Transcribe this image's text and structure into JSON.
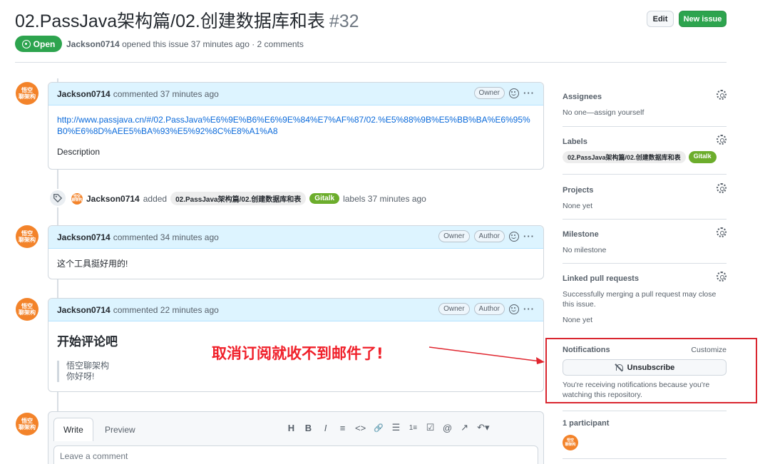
{
  "header": {
    "title": "02.PassJava架构篇/02.创建数据库和表",
    "number": "#32",
    "edit_label": "Edit",
    "new_issue_label": "New issue",
    "state": "Open",
    "author": "Jackson0714",
    "meta_text": "opened this issue 37 minutes ago · 2 comments"
  },
  "avatar_text": "悟空\n聊架构",
  "comments": [
    {
      "author": "Jackson0714",
      "action": "commented 37 minutes ago",
      "roles": [
        "Owner"
      ],
      "link": "http://www.passjava.cn/#/02.PassJava%E6%9E%B6%E6%9E%84%E7%AF%87/02.%E5%88%9B%E5%BB%BA%E6%95%B0%E6%8D%AEE5%BA%93%E5%92%8C%E8%A1%A8",
      "body": "Description"
    },
    {
      "author": "Jackson0714",
      "action": "commented 34 minutes ago",
      "roles": [
        "Owner",
        "Author"
      ],
      "body": "这个工具挺好用的!"
    },
    {
      "author": "Jackson0714",
      "action": "commented 22 minutes ago",
      "roles": [
        "Owner",
        "Author"
      ],
      "heading": "开始评论吧",
      "quote_lines": [
        "悟空聊架构",
        "你好呀!"
      ]
    }
  ],
  "label_event": {
    "author": "Jackson0714",
    "verb": "added",
    "labels": [
      "02.PassJava架构篇/02.创建数据库和表",
      "Gitalk"
    ],
    "suffix": "labels 37 minutes ago"
  },
  "annotation": {
    "text": "取消订阅就收不到邮件了!",
    "color": "#f0202a"
  },
  "editor": {
    "tab_write": "Write",
    "tab_preview": "Preview",
    "toolbar": [
      "H",
      "B",
      "I",
      "≡",
      "<>",
      "🔗",
      "☰",
      "1≡",
      "☑",
      "@",
      "↗",
      "↶▾"
    ],
    "placeholder": "Leave a comment"
  },
  "sidebar": {
    "assignees_title": "Assignees",
    "assignees_value": "No one—assign yourself",
    "labels_title": "Labels",
    "labels": [
      "02.PassJava架构篇/02.创建数据库和表",
      "Gitalk"
    ],
    "projects_title": "Projects",
    "projects_value": "None yet",
    "milestone_title": "Milestone",
    "milestone_value": "No milestone",
    "linked_title": "Linked pull requests",
    "linked_desc": "Successfully merging a pull request may close this issue.",
    "linked_value": "None yet",
    "notifications_title": "Notifications",
    "customize_label": "Customize",
    "unsubscribe_label": "Unsubscribe",
    "notifications_desc": "You're receiving notifications because you're watching this repository.",
    "participants_title": "1 participant"
  },
  "colors": {
    "brand_green": "#2da44e",
    "label_green": "#6cad2c",
    "highlight_red": "#d9262f",
    "link_blue": "#0969da"
  }
}
